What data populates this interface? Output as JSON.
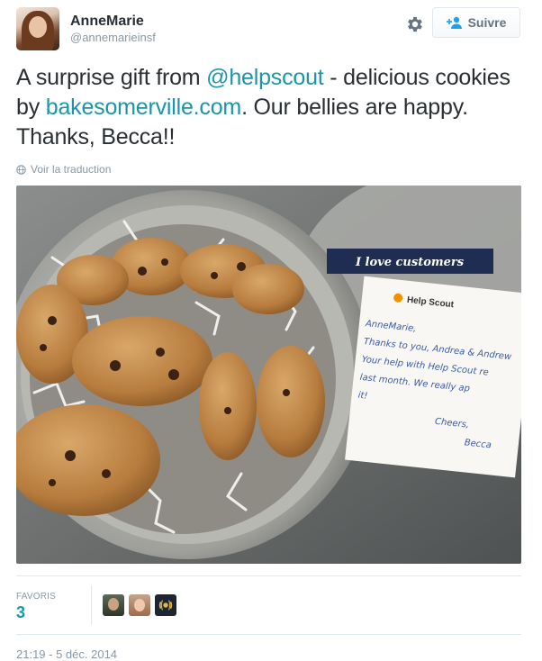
{
  "user": {
    "fullname": "AnneMarie",
    "handle": "@annemarieinsf"
  },
  "actions": {
    "follow_label": "Suivre",
    "settings_icon": "gear-icon",
    "follow_icon": "add-user-icon"
  },
  "tweet": {
    "text_part1": "A surprise gift from ",
    "mention": "@helpscout",
    "text_part2": " - delicious cookies by ",
    "link": "bakesomerville.com",
    "text_part3": ". Our bellies are happy. Thanks, Becca!!",
    "translate_label": "Voir la traduction",
    "translate_icon": "globe-icon"
  },
  "photo": {
    "banner_text": "I love customers",
    "card_logo": "Help Scout",
    "card_note_lines": [
      "AnneMarie,",
      "Thanks to you, Andrea & Andrew",
      "Your help with Help Scout re",
      "last month. We really ap",
      "it!",
      "Cheers,",
      "Becca"
    ]
  },
  "stats": {
    "favorites_label": "FAVORIS",
    "favorites_count": "3"
  },
  "timestamp": "21:19 - 5 déc. 2014",
  "colors": {
    "link": "#1b95a8",
    "muted": "#8899a6",
    "text": "#292f33",
    "border": "#e1e8ed"
  }
}
